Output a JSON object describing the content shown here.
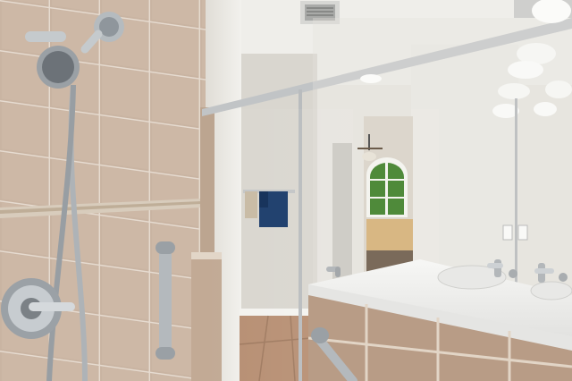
{
  "scene": {
    "description_name": "bathroom-walk-in-shower-photo",
    "colors": {
      "tile": "#c9b4a2",
      "tile_dark": "#a88f7c",
      "grout": "#e6dbd0",
      "wall": "#ecebe6",
      "ceiling": "#f1f0ec",
      "countertop": "#f3f3f1",
      "chrome": "#c8cbce",
      "towel": "#1f3f6e",
      "bed": "#d9b98c",
      "window_green": "#4f8a3a"
    }
  }
}
